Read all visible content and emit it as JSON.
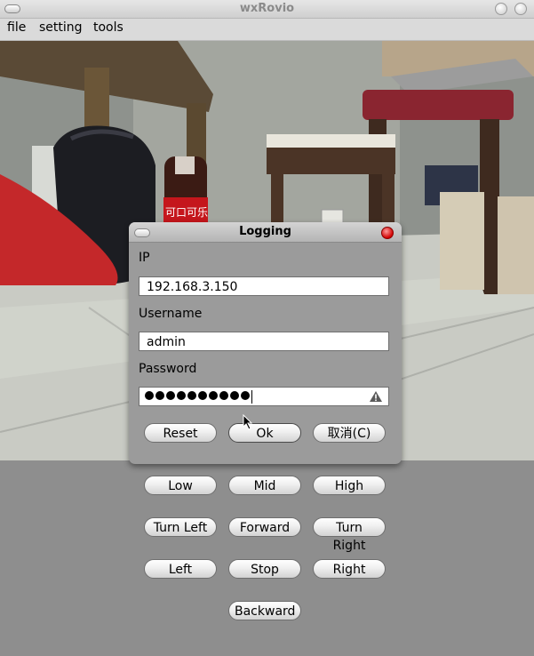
{
  "window": {
    "title": "wxRovio"
  },
  "menu": [
    "file",
    "setting",
    "tools"
  ],
  "dialog": {
    "title": "Logging",
    "ip_label": "IP",
    "ip_value": "192.168.3.150",
    "username_label": "Username",
    "username_value": "admin",
    "password_label": "Password",
    "password_dot_count": 10,
    "reset_label": "Reset",
    "ok_label": "Ok",
    "cancel_label": "取消(C)"
  },
  "controls": {
    "speed": [
      "Low",
      "Mid",
      "High"
    ],
    "turn": [
      "Turn Left",
      "Forward",
      "Turn Right"
    ],
    "move": [
      "Left",
      "Stop",
      "Right"
    ],
    "back": "Backward"
  },
  "camera_scene": {
    "bottle_label": "可口可乐"
  },
  "colors": {
    "dialog_bg": "#9b9b9b",
    "panel_bg": "#8e8e8e",
    "close_red": "#d10000"
  }
}
